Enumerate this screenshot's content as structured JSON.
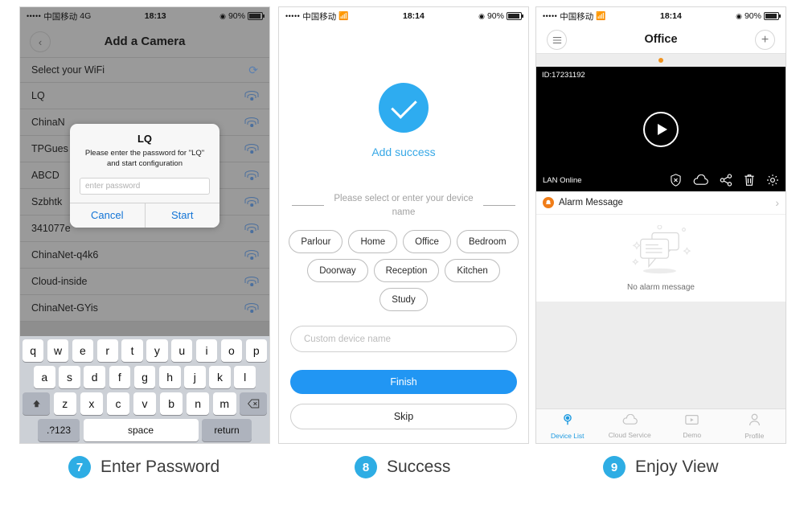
{
  "phone1": {
    "status": {
      "carrier": "中国移动",
      "network": "4G",
      "time": "18:13",
      "battery": "90%",
      "dots": "•••••"
    },
    "nav": {
      "title": "Add a Camera",
      "back_icon": "chevron-left-icon"
    },
    "wifi_header": {
      "label": "Select your WiFi",
      "refresh_icon": "refresh-icon"
    },
    "wifi_networks": [
      "LQ",
      "ChinaN",
      "TPGues",
      "ABCD",
      "Szbhtk",
      "341077e",
      "ChinaNet-q4k6",
      "Cloud-inside",
      "ChinaNet-GYis"
    ],
    "dialog": {
      "title": "LQ",
      "message": "Please enter the password for \"LQ\" and start configuration",
      "input_placeholder": "enter password",
      "input_value": "",
      "cancel_label": "Cancel",
      "start_label": "Start"
    },
    "keyboard": {
      "row1": [
        "q",
        "w",
        "e",
        "r",
        "t",
        "y",
        "u",
        "i",
        "o",
        "p"
      ],
      "row2": [
        "a",
        "s",
        "d",
        "f",
        "g",
        "h",
        "j",
        "k",
        "l"
      ],
      "row3": [
        "z",
        "x",
        "c",
        "v",
        "b",
        "n",
        "m"
      ],
      "shift_icon": "shift-icon",
      "backspace_icon": "backspace-icon",
      "numbers_label": ".?123",
      "space_label": "space",
      "return_label": "return"
    }
  },
  "phone2": {
    "status": {
      "carrier": "中国移动",
      "network": "wifi",
      "time": "18:14",
      "battery": "90%",
      "dots": "•••••"
    },
    "success": {
      "icon": "check-circle-icon",
      "label": "Add success"
    },
    "prompt": "Please select or enter your device name",
    "chips": [
      "Parlour",
      "Home",
      "Office",
      "Bedroom",
      "Doorway",
      "Reception",
      "Kitchen",
      "Study"
    ],
    "custom_input": {
      "placeholder": "Custom device name",
      "value": ""
    },
    "finish_label": "Finish",
    "skip_label": "Skip"
  },
  "phone3": {
    "status": {
      "carrier": "中国移动",
      "network": "wifi",
      "time": "18:14",
      "battery": "90%",
      "dots": "•••••"
    },
    "nav": {
      "title": "Office",
      "menu_icon": "list-icon",
      "add_icon": "plus-icon"
    },
    "video": {
      "device_id": "ID:17231192",
      "play_icon": "play-icon",
      "status_label": "LAN Online",
      "icons": [
        "shield-off-icon",
        "cloud-icon",
        "share-icon",
        "trash-icon",
        "gear-icon"
      ]
    },
    "alarm": {
      "title": "Alarm Message",
      "icon": "alarm-bell-icon",
      "chevron_icon": "chevron-right-icon",
      "empty_label": "No alarm message",
      "empty_icon": "empty-chat-icon"
    },
    "tabs": [
      {
        "label": "Device List",
        "icon": "camera-icon",
        "active": true
      },
      {
        "label": "Cloud Service",
        "icon": "cloud-icon",
        "active": false
      },
      {
        "label": "Demo",
        "icon": "play-box-icon",
        "active": false
      },
      {
        "label": "Profile",
        "icon": "person-icon",
        "active": false
      }
    ]
  },
  "captions": [
    {
      "num": "7",
      "text": "Enter Password"
    },
    {
      "num": "8",
      "text": "Success"
    },
    {
      "num": "9",
      "text": "Enjoy View"
    }
  ],
  "colors": {
    "accent": "#2eade4",
    "primary_blue": "#2196f3",
    "orange": "#f07d18",
    "link_blue": "#1274d6"
  }
}
